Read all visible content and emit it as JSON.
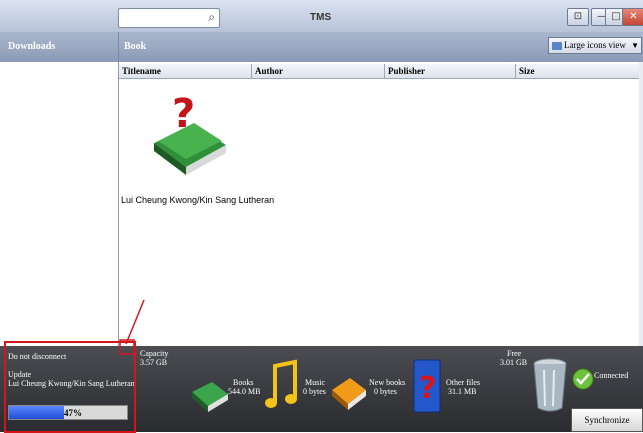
{
  "window": {
    "search_placeholder": "",
    "brand": "TMS",
    "restore_symbol": "⊡",
    "minimize_symbol": "—",
    "maximize_symbol": "□",
    "close_symbol": "✕"
  },
  "header": {
    "left_title": "Downloads",
    "main_title": "Book",
    "view_mode": "Large icons view"
  },
  "table": {
    "columns": [
      "Titlename",
      "Author",
      "Publisher",
      "Size"
    ]
  },
  "items": [
    {
      "caption": "Lui Cheung Kwong/Kin Sang Lutheran",
      "icon": "help-book-icon"
    }
  ],
  "status": {
    "warning": "Do not disconnect",
    "action": "Update",
    "item": "Lui Cheung Kwong/Kin Sang Lutheran",
    "progress_percent": 47,
    "progress_text": "47%"
  },
  "stats": {
    "capacity_label": "Capacity",
    "capacity_value": "3.57 GB",
    "books_label": "Books",
    "books_value": "544.0 MB",
    "music_label": "Music",
    "music_value": "0 bytes",
    "new_books_label": "New books",
    "new_books_value": "0 bytes",
    "other_label": "Other files",
    "other_value": "31.1 MB",
    "free_label": "Free",
    "free_value": "3.01 GB",
    "connection": "Connected"
  },
  "buttons": {
    "synchronize": "Synchronize"
  },
  "colors": {
    "annotation": "#d4161b",
    "bottom_bar": "#3a3b40",
    "progress": "#2f5ef0"
  }
}
